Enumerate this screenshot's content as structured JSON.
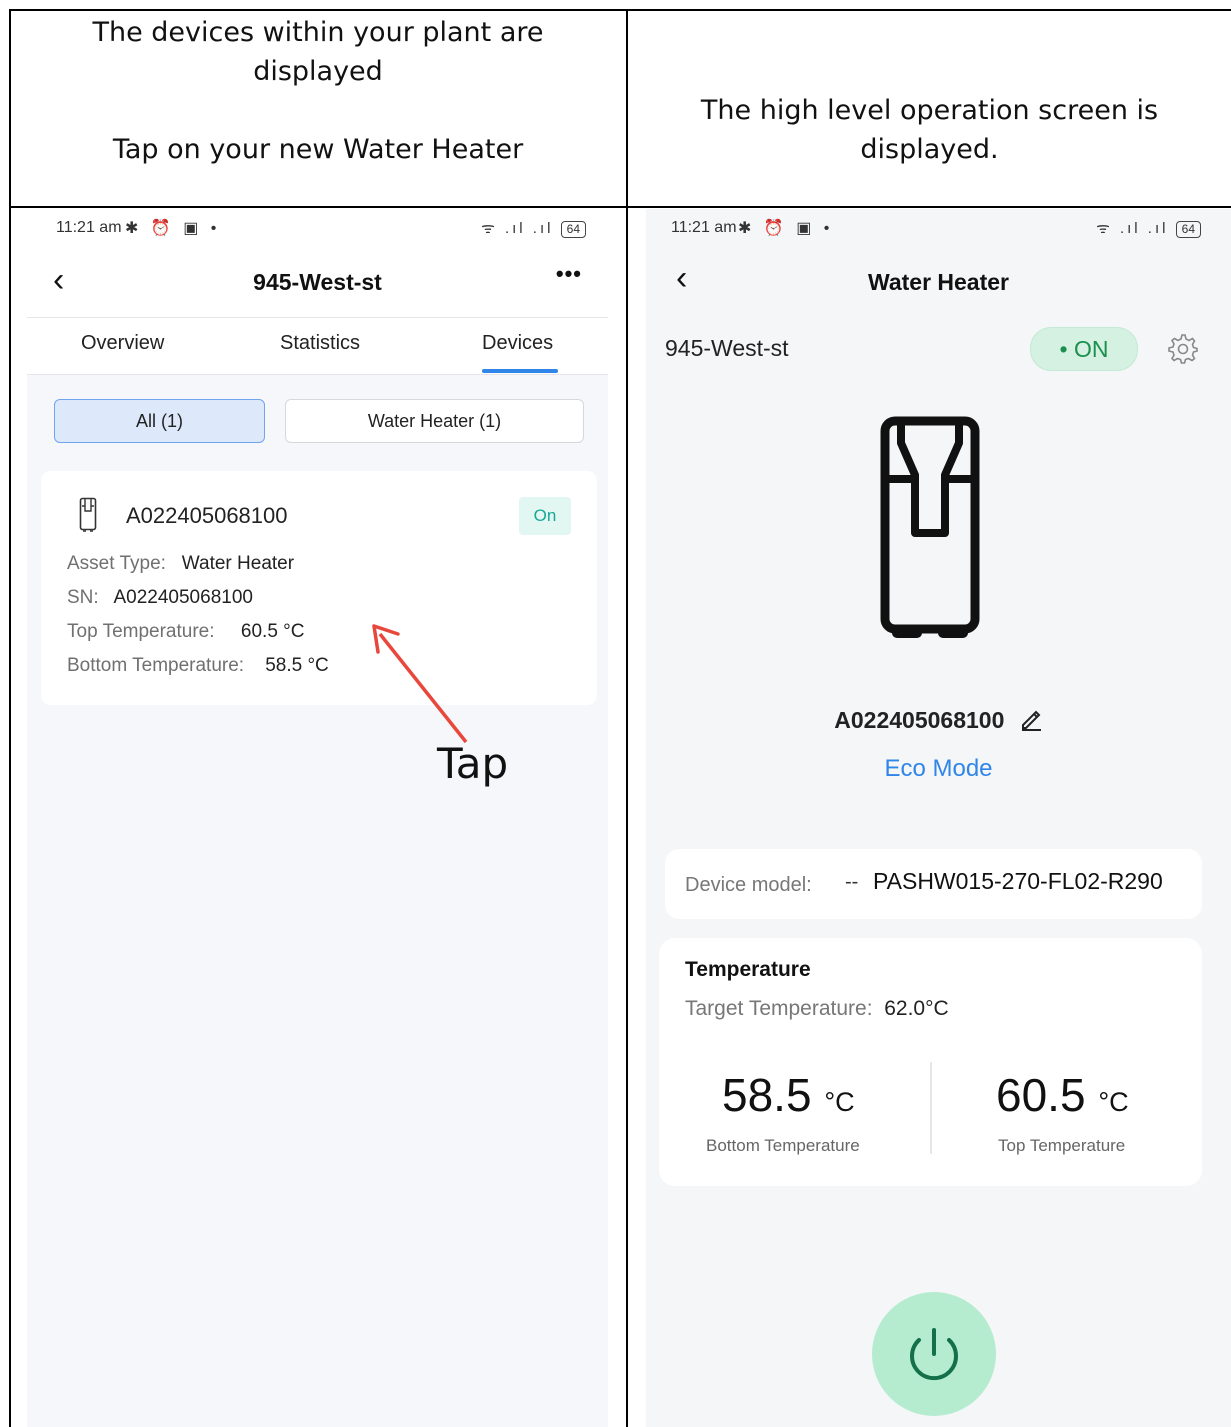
{
  "captions": {
    "left_line1": "The devices within your plant are",
    "left_line2": "displayed",
    "left_line3": "Tap on your new Water Heater",
    "right_line1": "The high level operation screen is",
    "right_line2": "displayed."
  },
  "status_bar": {
    "time": "11:21 am",
    "icons_left": "✱ ⏰ ▣ •",
    "icons_right": "ᯤ .ıl .ıl",
    "battery": "64"
  },
  "devices_screen": {
    "title": "945-West-st",
    "more": "•••",
    "tabs": [
      "Overview",
      "Statistics",
      "Devices"
    ],
    "active_tab": "Devices",
    "filters": [
      "All (1)",
      "Water Heater (1)"
    ],
    "device": {
      "name": "A022405068100",
      "status": "On",
      "asset_type_label": "Asset Type:",
      "asset_type": "Water Heater",
      "sn_label": "SN:",
      "sn": "A022405068100",
      "top_temp_label": "Top Temperature:",
      "top_temp": "60.5 °C",
      "bottom_temp_label": "Bottom Temperature:",
      "bottom_temp": "58.5 °C"
    },
    "annotation": "Tap"
  },
  "detail_screen": {
    "title": "Water Heater",
    "plant": "945-West-st",
    "status": "• ON",
    "device_name": "A022405068100",
    "mode": "Eco Mode",
    "model_label": "Device model:",
    "model_dash": "--",
    "model_value": "PASHW015-270-FL02-R290",
    "temperature_heading": "Temperature",
    "target_label": "Target Temperature:",
    "target_value": "62.0°C",
    "bottom_value": "58.5",
    "bottom_unit": "°C",
    "bottom_label": "Bottom Temperature",
    "top_value": "60.5",
    "top_unit": "°C",
    "top_label": "Top Temperature"
  },
  "colors": {
    "accent_blue": "#2f86e8",
    "on_green": "#1c8f4e",
    "power_green": "#b5ecd0",
    "arrow_red": "#e8473c"
  }
}
